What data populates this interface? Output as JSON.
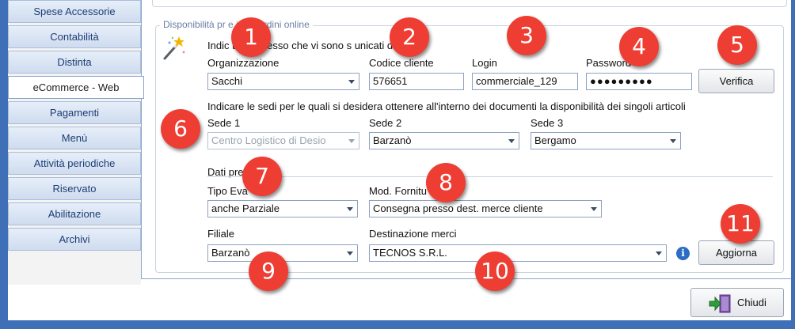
{
  "sidebar": {
    "items": [
      {
        "label": "Spese Accessorie"
      },
      {
        "label": "Contabilità"
      },
      {
        "label": "Distinta"
      },
      {
        "label": "eCommerce - Web"
      },
      {
        "label": "Pagamenti"
      },
      {
        "label": "Menù"
      },
      {
        "label": "Attività periodiche"
      },
      {
        "label": "Riservato"
      },
      {
        "label": "Abilitazione"
      },
      {
        "label": "Archivi"
      }
    ],
    "active_index": 3
  },
  "group": {
    "title": "Disponibilità pr     e invio ordini online",
    "access_intro": "Indic     ti di accesso che vi sono s       unicati dal forni",
    "organizzazione": {
      "label": "Organizzazione",
      "value": "Sacchi"
    },
    "codice_cliente": {
      "label": "Codice cliente",
      "value": "576651"
    },
    "login": {
      "label": "Login",
      "value": "commerciale_129"
    },
    "password": {
      "label": "Password",
      "value": "●●●●●●●●●"
    },
    "verifica_label": "Verifica",
    "sedi_intro": "Indicare le sedi per le quali si desidera ottenere all'interno dei documenti la disponibilità dei singoli articoli",
    "sede1": {
      "label": "Sede 1",
      "value": "Centro Logistico di Desio"
    },
    "sede2": {
      "label": "Sede 2",
      "value": "Barzanò"
    },
    "sede3": {
      "label": "Sede 3",
      "value": "Bergamo"
    },
    "dati_label": "Dati pre",
    "tipo_evasione": {
      "label": "Tipo Eva",
      "value": "anche Parziale"
    },
    "mod_fornitura": {
      "label": "Mod. Fornitu",
      "value": "Consegna presso dest. merce cliente"
    },
    "filiale": {
      "label": "Filiale",
      "value": "Barzanò"
    },
    "destinazione": {
      "label": "Destinazione merci",
      "value": "TECNOS S.R.L."
    },
    "info_icon": "i",
    "aggiorna_label": "Aggiorna"
  },
  "footer": {
    "chiudi_label": "Chiudi"
  },
  "badges": [
    "1",
    "2",
    "3",
    "4",
    "5",
    "6",
    "7",
    "8",
    "9",
    "10",
    "11"
  ],
  "colors": {
    "badge": "#ee3d33",
    "frame_blue": "#3f6fb7",
    "accent_text": "#1c3d74"
  }
}
